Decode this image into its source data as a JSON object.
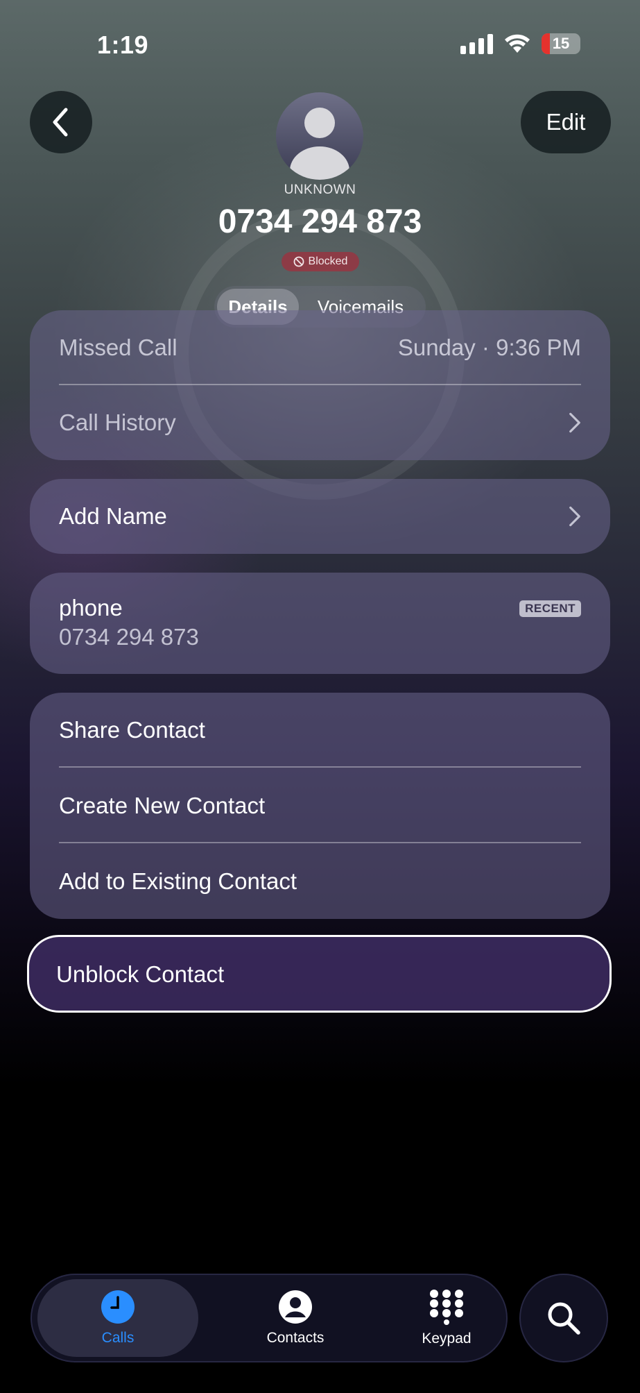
{
  "status_bar": {
    "time": "1:19",
    "battery": "15"
  },
  "header": {
    "edit_label": "Edit",
    "caller_label": "UNKNOWN",
    "number": "0734 294 873",
    "blocked_label": "Blocked"
  },
  "segments": {
    "details": "Details",
    "voicemails": "Voicemails"
  },
  "call_card": {
    "missed_label": "Missed Call",
    "missed_time": "Sunday · 9:36 PM",
    "history_label": "Call History"
  },
  "add_name": {
    "label": "Add Name"
  },
  "phone_card": {
    "label": "phone",
    "number": "0734 294 873",
    "tag": "RECENT"
  },
  "actions": {
    "share": "Share Contact",
    "create": "Create New Contact",
    "add_existing": "Add to Existing Contact"
  },
  "unblock": {
    "label": "Unblock Contact"
  },
  "tabbar": {
    "calls": "Calls",
    "contacts": "Contacts",
    "keypad": "Keypad"
  },
  "colors": {
    "accent": "#2a8eff",
    "blocked": "#aa2837",
    "battery_low": "#e5322d"
  }
}
